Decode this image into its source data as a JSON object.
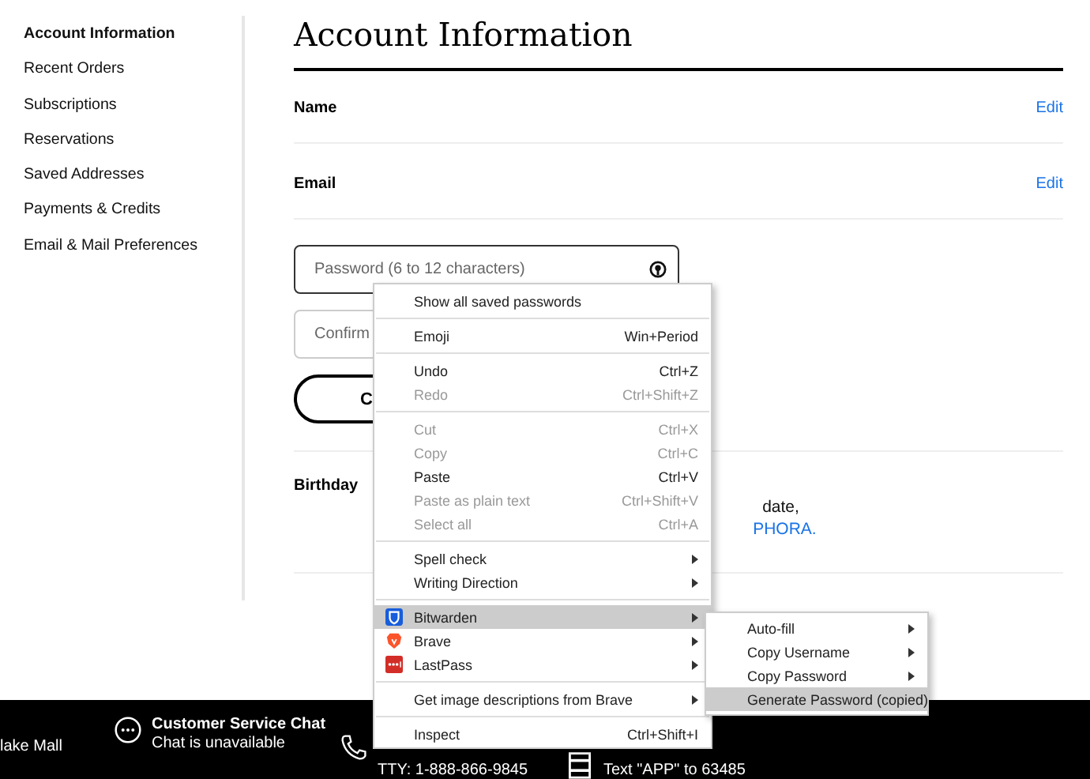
{
  "sidebar": {
    "items": [
      {
        "label": "Account Information",
        "selected": true
      },
      {
        "label": "Recent Orders",
        "selected": false
      },
      {
        "label": "Subscriptions",
        "selected": false
      },
      {
        "label": "Reservations",
        "selected": false
      },
      {
        "label": "Saved Addresses",
        "selected": false
      },
      {
        "label": "Payments & Credits",
        "selected": false
      },
      {
        "label": "Email & Mail Preferences",
        "selected": false
      }
    ]
  },
  "main": {
    "title": "Account Information",
    "name_row": {
      "label": "Name",
      "action": "Edit"
    },
    "email_row": {
      "label": "Email",
      "action": "Edit"
    },
    "password_field": {
      "placeholder": "Password (6 to 12 characters)"
    },
    "confirm_field": {
      "placeholder": "Confirm"
    },
    "button": {
      "label": "C"
    },
    "birthday": {
      "label": "Birthday",
      "text": "date,",
      "link": "PHORA."
    }
  },
  "context_menu": {
    "groups": [
      [
        {
          "label": "Show all saved passwords",
          "disabled": false,
          "submenu": false,
          "selected": false
        }
      ],
      [
        {
          "label": "Emoji",
          "shortcut": "Win+Period",
          "disabled": false,
          "submenu": false,
          "selected": false
        }
      ],
      [
        {
          "label": "Undo",
          "shortcut": "Ctrl+Z",
          "disabled": false,
          "submenu": false,
          "selected": false
        },
        {
          "label": "Redo",
          "shortcut": "Ctrl+Shift+Z",
          "disabled": true,
          "submenu": false,
          "selected": false
        }
      ],
      [
        {
          "label": "Cut",
          "shortcut": "Ctrl+X",
          "disabled": true,
          "submenu": false,
          "selected": false
        },
        {
          "label": "Copy",
          "shortcut": "Ctrl+C",
          "disabled": true,
          "submenu": false,
          "selected": false
        },
        {
          "label": "Paste",
          "shortcut": "Ctrl+V",
          "disabled": false,
          "submenu": false,
          "selected": false
        },
        {
          "label": "Paste as plain text",
          "shortcut": "Ctrl+Shift+V",
          "disabled": true,
          "submenu": false,
          "selected": false
        },
        {
          "label": "Select all",
          "shortcut": "Ctrl+A",
          "disabled": true,
          "submenu": false,
          "selected": false
        }
      ],
      [
        {
          "label": "Spell check",
          "disabled": false,
          "submenu": true,
          "selected": false
        },
        {
          "label": "Writing Direction",
          "disabled": false,
          "submenu": true,
          "selected": false
        }
      ],
      [
        {
          "label": "Bitwarden",
          "kind": "bitwarden",
          "disabled": false,
          "submenu": true,
          "selected": true
        },
        {
          "label": "Brave",
          "kind": "brave",
          "disabled": false,
          "submenu": true,
          "selected": false
        },
        {
          "label": "LastPass",
          "kind": "lastpass",
          "disabled": false,
          "submenu": true,
          "selected": false
        }
      ],
      [
        {
          "label": "Get image descriptions from Brave",
          "disabled": false,
          "submenu": true,
          "selected": false
        }
      ],
      [
        {
          "label": "Inspect",
          "shortcut": "Ctrl+Shift+I",
          "disabled": false,
          "submenu": false,
          "selected": false
        }
      ]
    ]
  },
  "submenu": {
    "items": [
      {
        "label": "Auto-fill",
        "submenu": true,
        "selected": false
      },
      {
        "label": "Copy Username",
        "submenu": true,
        "selected": false
      },
      {
        "label": "Copy Password",
        "submenu": true,
        "selected": false
      },
      {
        "label": "Generate Password (copied)",
        "submenu": false,
        "selected": true
      }
    ]
  },
  "footer": {
    "store": "lake Mall",
    "items": [
      {
        "kind": "chat",
        "title": "Customer Service Chat",
        "subtitle": "Chat is unavailable"
      },
      {
        "kind": "phone",
        "subtitle": "TTY: 1-888-866-9845"
      },
      {
        "kind": "app",
        "subtitle": "Text \"APP\" to 63485"
      }
    ]
  }
}
